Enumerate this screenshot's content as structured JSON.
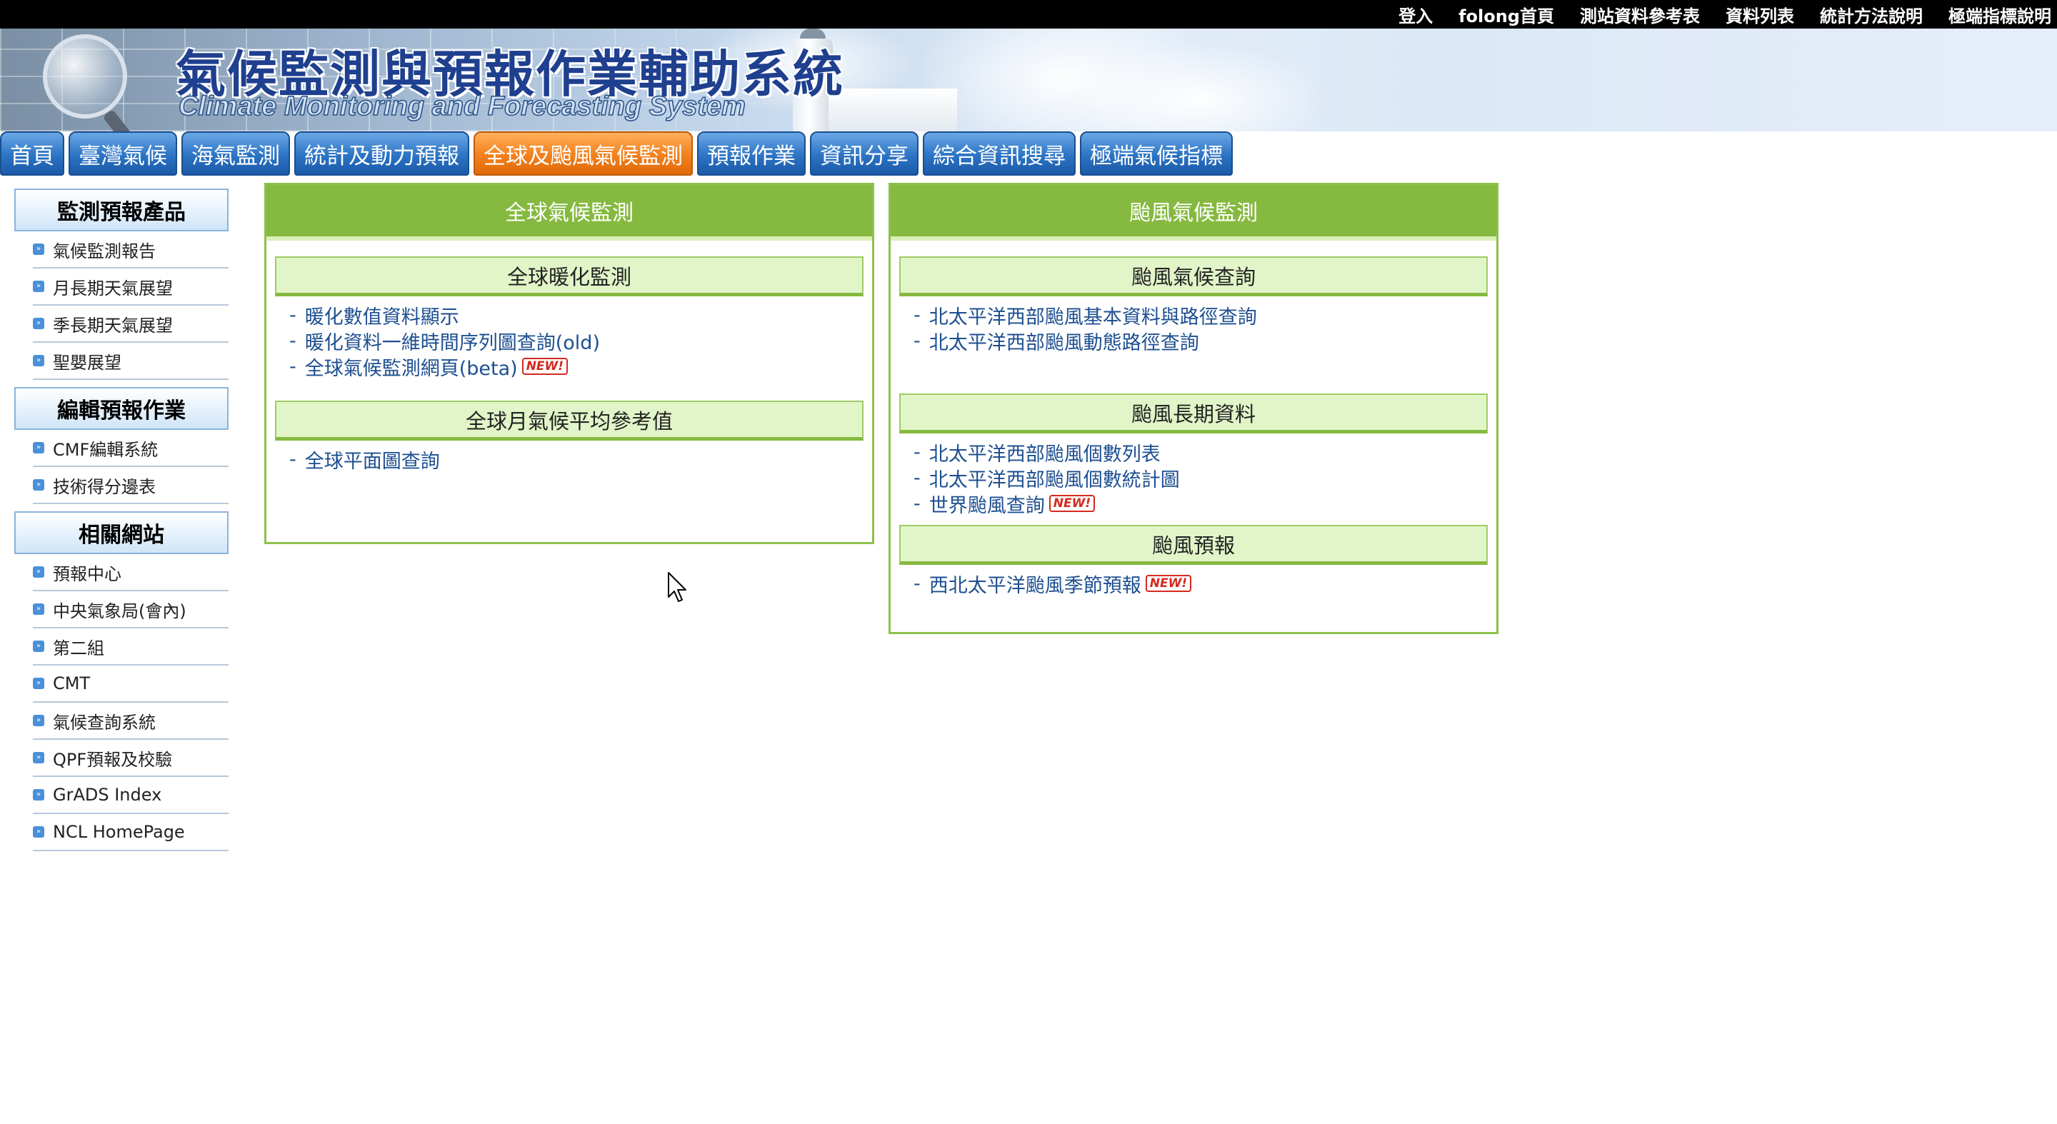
{
  "topbar": {
    "links": [
      "登入",
      "folong首頁",
      "測站資料參考表",
      "資料列表",
      "統計方法說明",
      "極端指標說明"
    ]
  },
  "banner": {
    "title_zh": "氣候監測與預報作業輔助系統",
    "title_en": "Climate Monitoring and Forecasting System"
  },
  "nav": {
    "tabs": [
      "首頁",
      "臺灣氣候",
      "海氣監測",
      "統計及動力預報",
      "全球及颱風氣候監測",
      "預報作業",
      "資訊分享",
      "綜合資訊搜尋",
      "極端氣候指標"
    ],
    "active": "全球及颱風氣候監測"
  },
  "sidebar": {
    "sections": [
      {
        "title": "監測預報產品",
        "items": [
          "氣候監測報告",
          "月長期天氣展望",
          "季長期天氣展望",
          "聖嬰展望"
        ]
      },
      {
        "title": "編輯預報作業",
        "items": [
          "CMF編輯系統",
          "技術得分邊表"
        ]
      },
      {
        "title": "相關網站",
        "items": [
          "預報中心",
          "中央氣象局(會內)",
          "第二組",
          "CMT",
          "氣候查詢系統",
          "QPF預報及校驗",
          "GrADS Index",
          "NCL HomePage"
        ]
      }
    ]
  },
  "panels": {
    "global": {
      "title": "全球氣候監測",
      "sub1": {
        "title": "全球暖化監測",
        "links": [
          "暖化數值資料顯示",
          "暖化資料一維時間序列圖查詢(old)",
          "全球氣候監測網頁(beta)"
        ]
      },
      "sub2": {
        "title": "全球月氣候平均參考值",
        "links": [
          "全球平面圖查詢"
        ]
      }
    },
    "typhoon": {
      "title": "颱風氣候監測",
      "sub1": {
        "title": "颱風氣候查詢",
        "links": [
          "北太平洋西部颱風基本資料與路徑查詢",
          "北太平洋西部颱風動態路徑查詢"
        ]
      },
      "sub2": {
        "title": "颱風長期資料",
        "links": [
          "北太平洋西部颱風個數列表",
          "北太平洋西部颱風個數統計圖",
          "世界颱風查詢"
        ]
      },
      "sub3": {
        "title": "颱風預報",
        "links": [
          "西北太平洋颱風季節預報"
        ]
      }
    }
  },
  "badge": {
    "new": "NEW!"
  },
  "colors": {
    "panel_green": "#86b940",
    "nav_blue": "#2c74c4",
    "nav_active_orange": "#f2801c",
    "link_blue": "#1d4f91"
  }
}
